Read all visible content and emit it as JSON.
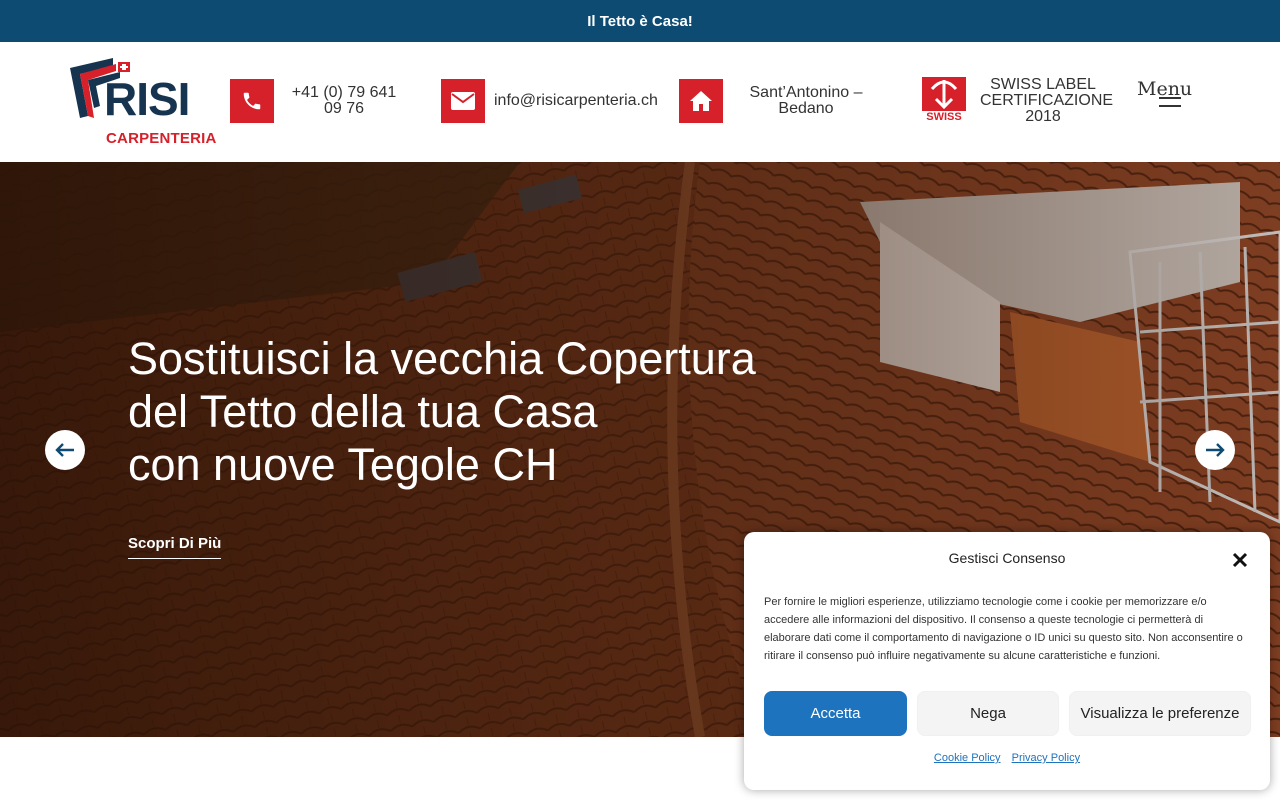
{
  "topbar": {
    "text": "Il Tetto è Casa!"
  },
  "logo": {
    "name": "RISI",
    "subtitle": "CARPENTERIA"
  },
  "header": {
    "phone": {
      "line1": "+41 (0) 79 641",
      "line2": "09 76"
    },
    "email": "info@risicarpenteria.ch",
    "address": {
      "line1": "Sant’Antonino –",
      "line2": "Bedano"
    },
    "swiss": {
      "badge": "SWISS",
      "line1": "SWISS LABEL",
      "line2": "CERTIFICAZIONE",
      "line3": "2018"
    },
    "menu_label": "Menu"
  },
  "hero": {
    "title_lines": [
      "Sostituisci la vecchia Copertura",
      "del Tetto della tua Casa",
      "con nuove Tegole CH"
    ],
    "cta_label": "Scopri Di Più"
  },
  "cookie": {
    "title": "Gestisci Consenso",
    "body": "Per fornire le migliori esperienze, utilizziamo tecnologie come i cookie per memorizzare e/o accedere alle informazioni del dispositivo. Il consenso a queste tecnologie ci permetterà di elaborare dati come il comportamento di navigazione o ID unici su questo sito. Non acconsentire o ritirare il consenso può influire negativamente su alcune caratteristiche e funzioni.",
    "accept_label": "Accetta",
    "deny_label": "Nega",
    "preferences_label": "Visualizza le preferenze",
    "cookie_policy_label": "Cookie Policy",
    "privacy_policy_label": "Privacy Policy"
  },
  "colors": {
    "topbar_bg": "#0d4b73",
    "brand_red": "#d6202a",
    "brand_navy": "#16344f",
    "accept_blue": "#1e73be"
  }
}
